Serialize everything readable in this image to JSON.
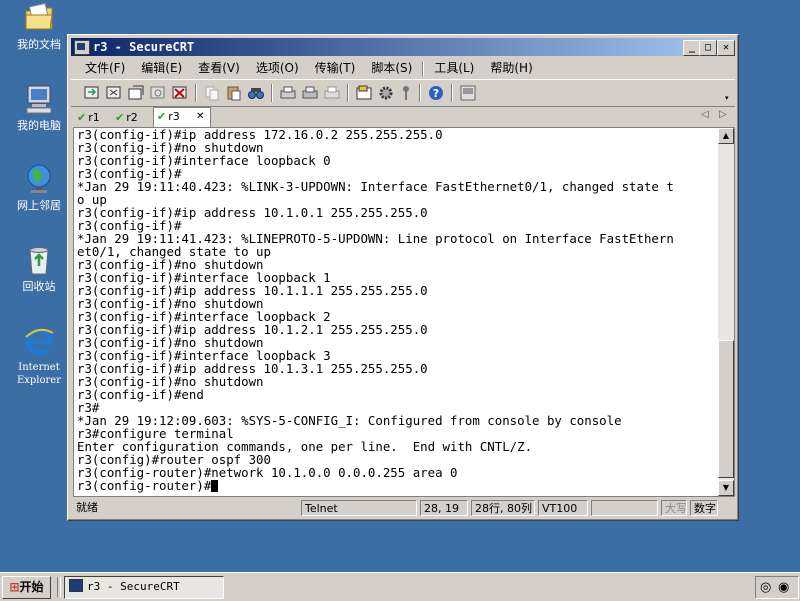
{
  "desktop": {
    "icons": [
      {
        "label": "我的文档"
      },
      {
        "label": "我的电脑"
      },
      {
        "label": "网上邻居"
      },
      {
        "label": "回收站"
      },
      {
        "label": "Internet Explorer"
      }
    ]
  },
  "window": {
    "title": "r3 - SecureCRT",
    "menu": [
      "文件(F)",
      "编辑(E)",
      "查看(V)",
      "选项(O)",
      "传输(T)",
      "脚本(S)",
      "工具(L)",
      "帮助(H)"
    ],
    "tabs": [
      {
        "label": "r1",
        "active": false
      },
      {
        "label": "r2",
        "active": false
      },
      {
        "label": "r3",
        "active": true
      }
    ],
    "close_tab_glyph": "✕",
    "terminal_lines": [
      "r3(config-if)#ip address 172.16.0.2 255.255.255.0",
      "r3(config-if)#no shutdown",
      "r3(config-if)#interface loopback 0",
      "r3(config-if)#",
      "*Jan 29 19:11:40.423: %LINK-3-UPDOWN: Interface FastEthernet0/1, changed state t",
      "o up",
      "r3(config-if)#ip address 10.1.0.1 255.255.255.0",
      "r3(config-if)#",
      "*Jan 29 19:11:41.423: %LINEPROTO-5-UPDOWN: Line protocol on Interface FastEthern",
      "et0/1, changed state to up",
      "r3(config-if)#no shutdown",
      "r3(config-if)#interface loopback 1",
      "r3(config-if)#ip address 10.1.1.1 255.255.255.0",
      "r3(config-if)#no shutdown",
      "r3(config-if)#interface loopback 2",
      "r3(config-if)#ip address 10.1.2.1 255.255.255.0",
      "r3(config-if)#no shutdown",
      "r3(config-if)#interface loopback 3",
      "r3(config-if)#ip address 10.1.3.1 255.255.255.0",
      "r3(config-if)#no shutdown",
      "r3(config-if)#end",
      "r3#",
      "*Jan 29 19:12:09.603: %SYS-5-CONFIG_I: Configured from console by console",
      "r3#configure terminal",
      "Enter configuration commands, one per line.  End with CNTL/Z.",
      "r3(config)#router ospf 300",
      "r3(config-router)#network 10.1.0.0 0.0.0.255 area 0",
      "r3(config-router)#"
    ],
    "status": {
      "ready": "就绪",
      "protocol": "Telnet",
      "cursor_pos": "28, 19",
      "size": "28行, 80列",
      "emulation": "VT100",
      "caps": "大写",
      "numlock": "数字"
    }
  },
  "taskbar": {
    "start_label": "开始",
    "task_label": "r3 - SecureCRT"
  },
  "colors": {
    "desktop": "#3a6ea5",
    "title_active_start": "#0a246a",
    "title_active_end": "#a6caf0",
    "check": "#2aa02a"
  }
}
